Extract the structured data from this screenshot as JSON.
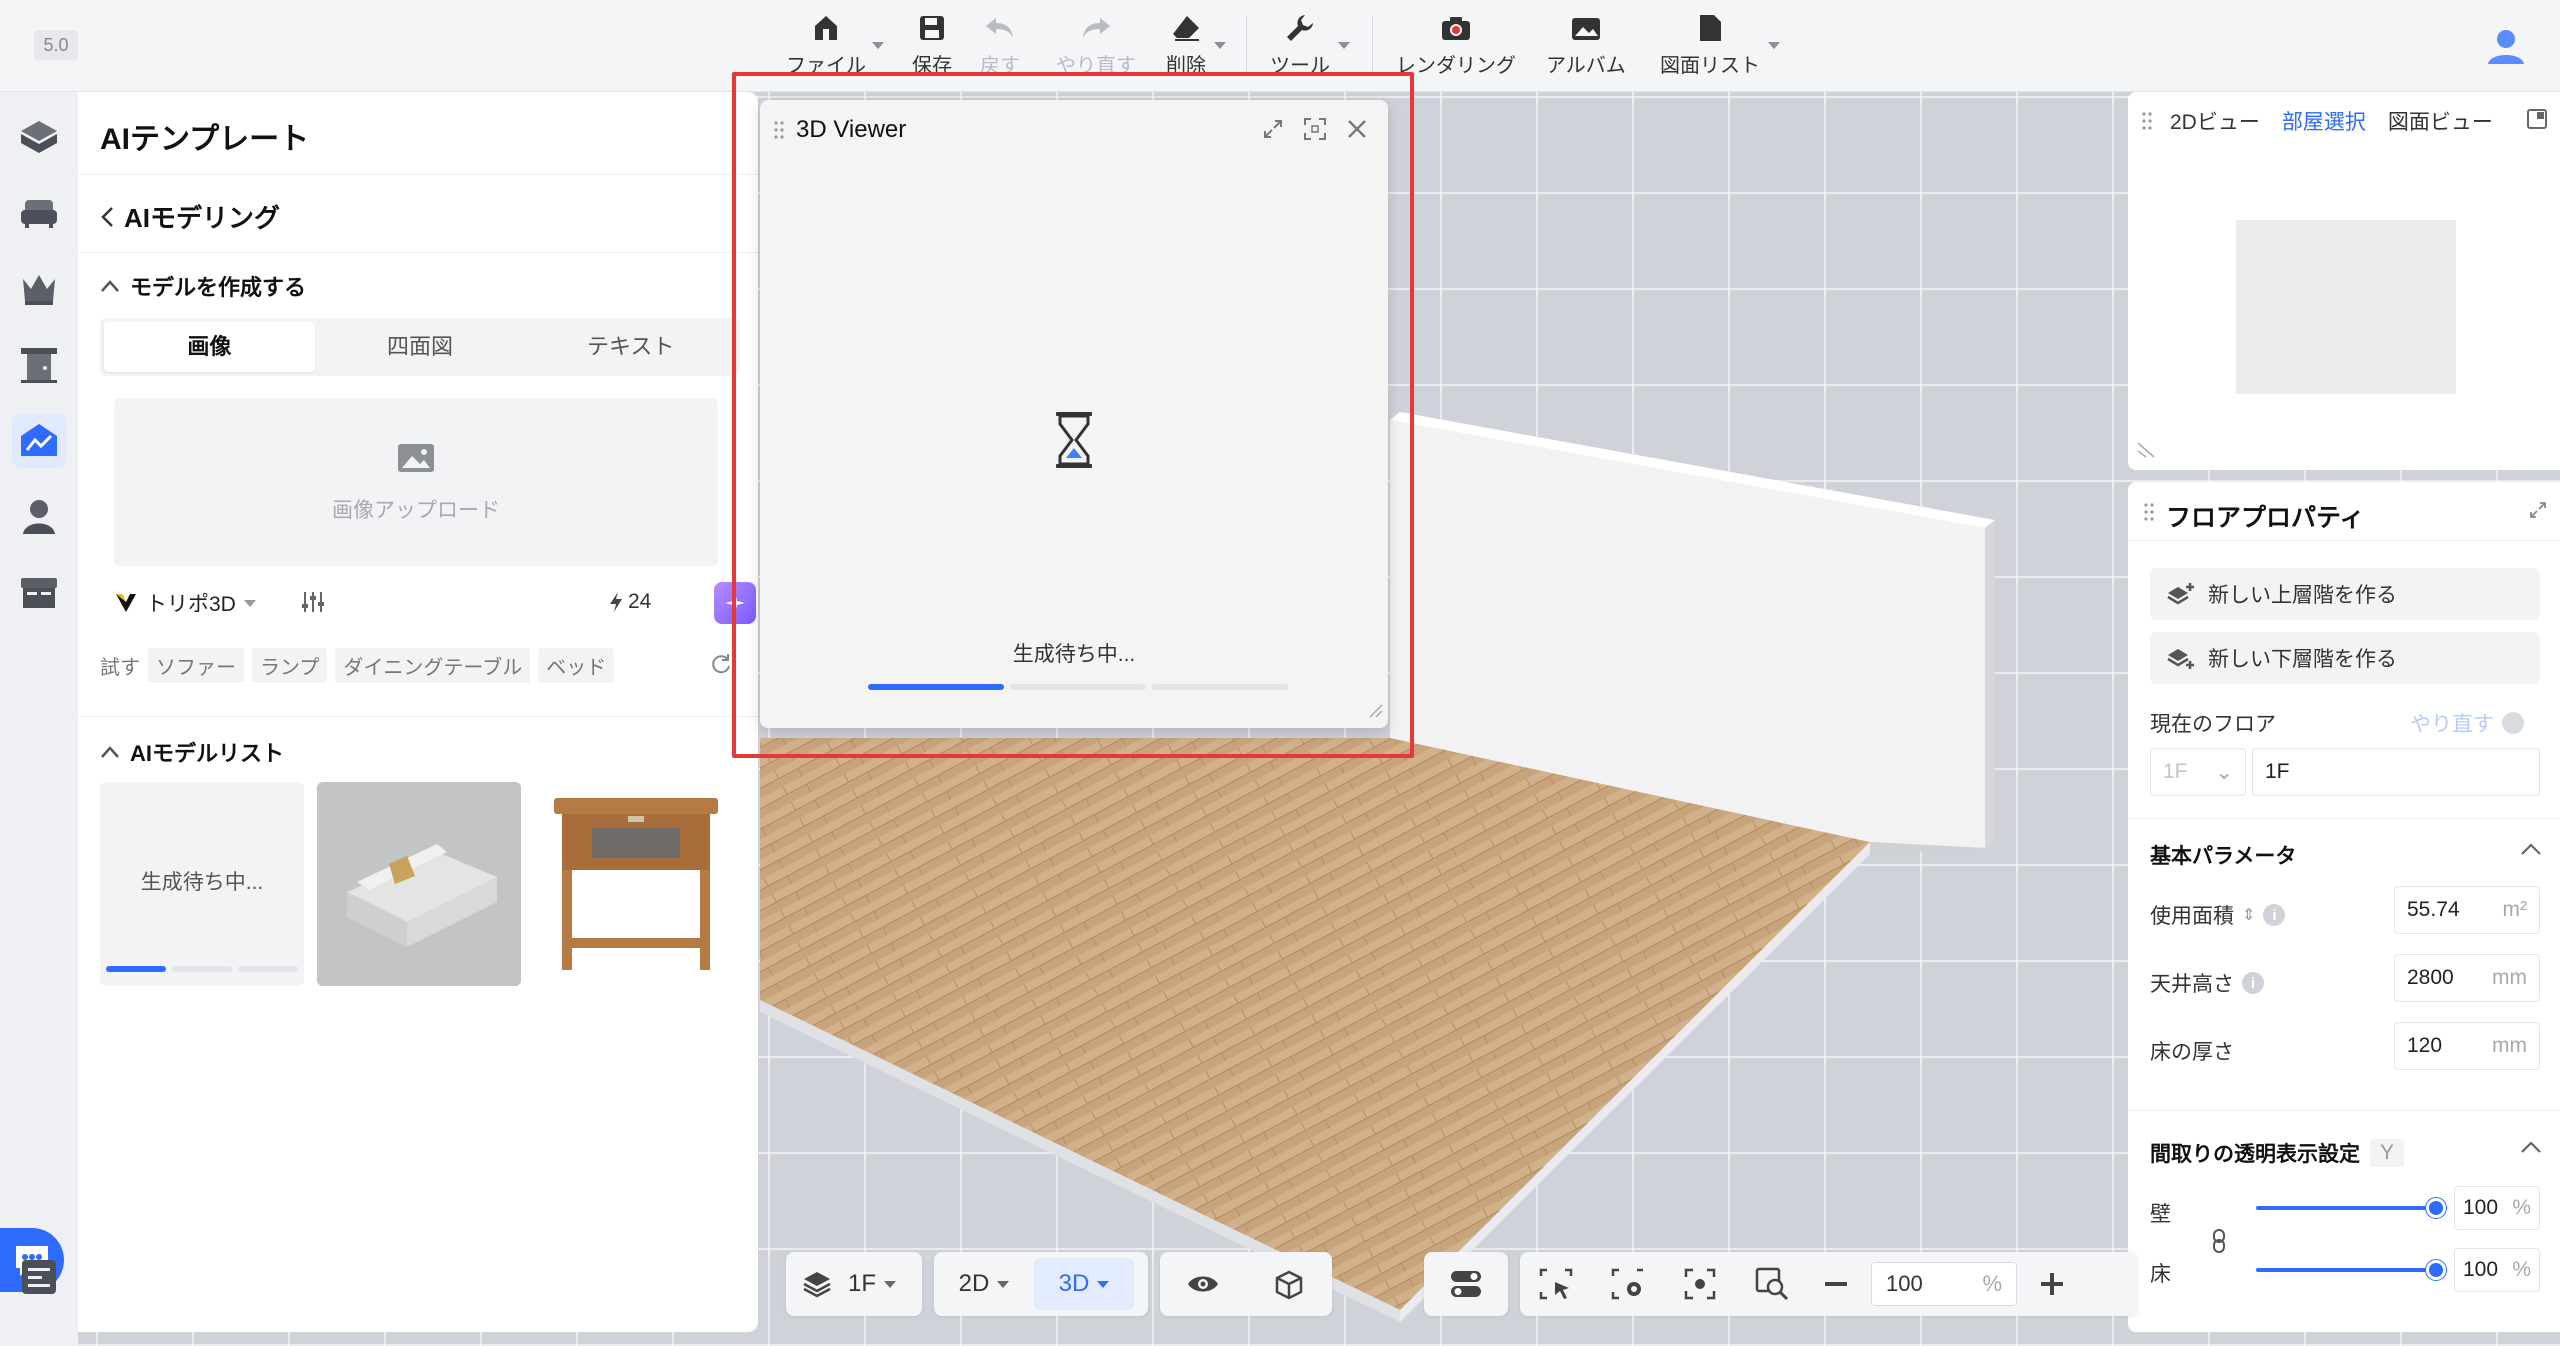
{
  "app": {
    "version": "5.0"
  },
  "toolbar": {
    "file": "ファイル",
    "save": "保存",
    "undo": "戻す",
    "redo": "やり直す",
    "delete": "削除",
    "tools": "ツール",
    "render": "レンダリング",
    "album": "アルバム",
    "drawing_list": "図面リスト"
  },
  "left_panel": {
    "title": "AIテンプレート",
    "back_label": "AIモデリング",
    "create_section": "モデルを作成する",
    "tabs": [
      {
        "label": "画像",
        "active": true
      },
      {
        "label": "四面図",
        "active": false
      },
      {
        "label": "テキスト",
        "active": false
      }
    ],
    "upload_label": "画像アップロード",
    "model_name": "トリポ3D",
    "credits": "24",
    "try_label": "試す",
    "try_tags": [
      "ソファー",
      "ランプ",
      "ダイニングテーブル",
      "ベッド"
    ],
    "model_list_section": "AIモデルリスト",
    "model_cards": [
      {
        "status": "生成待ち中...",
        "progress": 0.33
      },
      {
        "icon": "sofa-thumbnail"
      },
      {
        "icon": "nightstand-thumbnail"
      }
    ]
  },
  "viewer": {
    "title": "3D Viewer",
    "status": "生成待ち中...",
    "progress": 0.33
  },
  "view_panel": {
    "tabs": [
      {
        "label": "2Dビュー",
        "active": false
      },
      {
        "label": "部屋選択",
        "active": true
      },
      {
        "label": "図面ビュー",
        "active": false
      }
    ]
  },
  "floor_props": {
    "title": "フロアプロパティ",
    "add_upper": "新しい上層階を作る",
    "add_lower": "新しい下層階を作る",
    "current_floor_label": "現在のフロア",
    "redo_label": "やり直す",
    "floor_select": "1F",
    "floor_name": "1F",
    "basic_params": "基本パラメータ",
    "area_label": "使用面積",
    "area_value": "55.74",
    "area_unit": "m²",
    "ceiling_label": "天井高さ",
    "ceiling_value": "2800",
    "ceiling_unit": "mm",
    "floor_thickness_label": "床の厚さ",
    "floor_thickness_value": "120",
    "floor_thickness_unit": "mm",
    "transparency_section": "間取りの透明表示設定",
    "transparency_key": "Y",
    "wall_label": "壁",
    "wall_value": "100",
    "wall_level": 1.0,
    "floor_label": "床",
    "floor_value": "100",
    "floor_level": 1.0,
    "percent": "%"
  },
  "bottom_bar": {
    "floor": "1F",
    "view_2d": "2D",
    "view_3d": "3D",
    "zoom": "100",
    "zoom_unit": "%"
  },
  "colors": {
    "accent": "#2f6bff",
    "highlight": "#e5383b",
    "panel": "#ffffff",
    "toolbar": "#f4f5f7"
  }
}
